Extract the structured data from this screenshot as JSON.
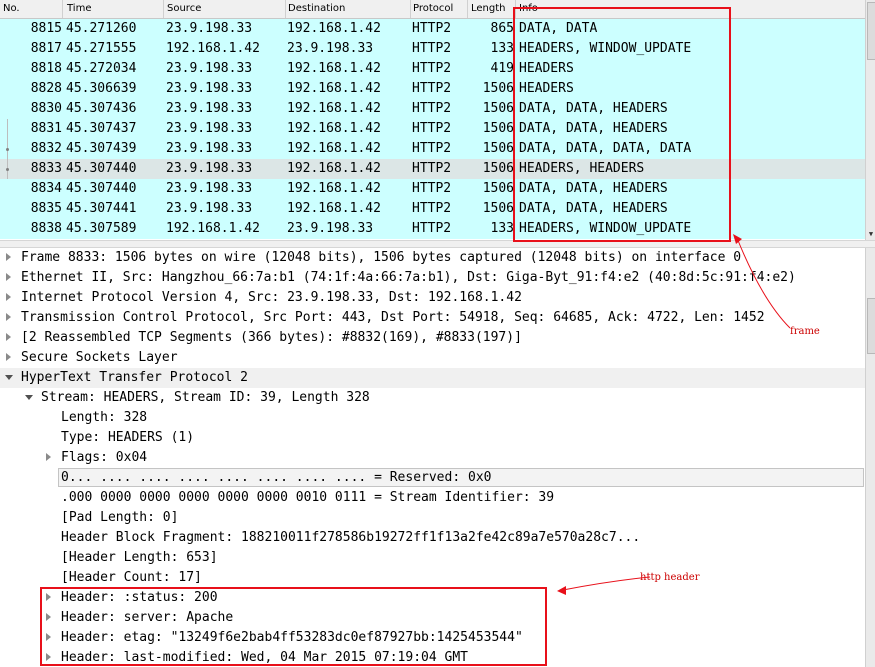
{
  "packet_list": {
    "columns": [
      "No.",
      "Time",
      "Source",
      "Destination",
      "Protocol",
      "Length",
      "Info"
    ],
    "rows": [
      {
        "no": "8815",
        "time": "45.271260",
        "src": "23.9.198.33",
        "dst": "192.168.1.42",
        "proto": "HTTP2",
        "len": "865",
        "info": "DATA, DATA"
      },
      {
        "no": "8817",
        "time": "45.271555",
        "src": "192.168.1.42",
        "dst": "23.9.198.33",
        "proto": "HTTP2",
        "len": "133",
        "info": "HEADERS, WINDOW_UPDATE"
      },
      {
        "no": "8818",
        "time": "45.272034",
        "src": "23.9.198.33",
        "dst": "192.168.1.42",
        "proto": "HTTP2",
        "len": "419",
        "info": "HEADERS"
      },
      {
        "no": "8828",
        "time": "45.306639",
        "src": "23.9.198.33",
        "dst": "192.168.1.42",
        "proto": "HTTP2",
        "len": "1506",
        "info": "HEADERS"
      },
      {
        "no": "8830",
        "time": "45.307436",
        "src": "23.9.198.33",
        "dst": "192.168.1.42",
        "proto": "HTTP2",
        "len": "1506",
        "info": "DATA, DATA, HEADERS"
      },
      {
        "no": "8831",
        "time": "45.307437",
        "src": "23.9.198.33",
        "dst": "192.168.1.42",
        "proto": "HTTP2",
        "len": "1506",
        "info": "DATA, DATA, HEADERS"
      },
      {
        "no": "8832",
        "time": "45.307439",
        "src": "23.9.198.33",
        "dst": "192.168.1.42",
        "proto": "HTTP2",
        "len": "1506",
        "info": "DATA, DATA, DATA, DATA"
      },
      {
        "no": "8833",
        "time": "45.307440",
        "src": "23.9.198.33",
        "dst": "192.168.1.42",
        "proto": "HTTP2",
        "len": "1506",
        "info": "HEADERS, HEADERS"
      },
      {
        "no": "8834",
        "time": "45.307440",
        "src": "23.9.198.33",
        "dst": "192.168.1.42",
        "proto": "HTTP2",
        "len": "1506",
        "info": "DATA, DATA, HEADERS"
      },
      {
        "no": "8835",
        "time": "45.307441",
        "src": "23.9.198.33",
        "dst": "192.168.1.42",
        "proto": "HTTP2",
        "len": "1506",
        "info": "DATA, DATA, HEADERS"
      },
      {
        "no": "8838",
        "time": "45.307589",
        "src": "192.168.1.42",
        "dst": "23.9.198.33",
        "proto": "HTTP2",
        "len": "133",
        "info": "HEADERS, WINDOW_UPDATE"
      }
    ]
  },
  "details": {
    "frame": "Frame 8833: 1506 bytes on wire (12048 bits), 1506 bytes captured (12048 bits) on interface 0",
    "ethernet": "Ethernet II, Src: Hangzhou_66:7a:b1 (74:1f:4a:66:7a:b1), Dst: Giga-Byt_91:f4:e2 (40:8d:5c:91:f4:e2)",
    "ip": "Internet Protocol Version 4, Src: 23.9.198.33, Dst: 192.168.1.42",
    "tcp": "Transmission Control Protocol, Src Port: 443, Dst Port: 54918, Seq: 64685, Ack: 4722, Len: 1452",
    "reassembled": "[2 Reassembled TCP Segments (366 bytes): #8832(169), #8833(197)]",
    "ssl": "Secure Sockets Layer",
    "http2": "HyperText Transfer Protocol 2",
    "stream": "Stream: HEADERS, Stream ID: 39, Length 328",
    "length": "Length: 328",
    "type": "Type: HEADERS (1)",
    "flags": "Flags: 0x04",
    "reserved": "0... .... .... .... .... .... .... .... = Reserved: 0x0",
    "stream_id": ".000 0000 0000 0000 0000 0000 0010 0111 = Stream Identifier: 39",
    "pad_length": "[Pad Length: 0]",
    "hbf": "Header Block Fragment: 188210011f278586b19272ff1f13a2fe42c89a7e570a28c7...",
    "header_length": "[Header Length: 653]",
    "header_count": "[Header Count: 17]",
    "headers": [
      "Header: :status: 200",
      "Header: server: Apache",
      "Header: etag: \"13249f6e2bab4ff53283dc0ef87927bb:1425453544\"",
      "Header: last-modified: Wed, 04 Mar 2015 07:19:04 GMT"
    ]
  },
  "annotations": {
    "frame_label": "frame",
    "http_header_label": "http header"
  },
  "colors": {
    "row_bg": "#ccffff",
    "selected_row_bg": "#dce6e6",
    "annotation_red": "#e8101a"
  }
}
